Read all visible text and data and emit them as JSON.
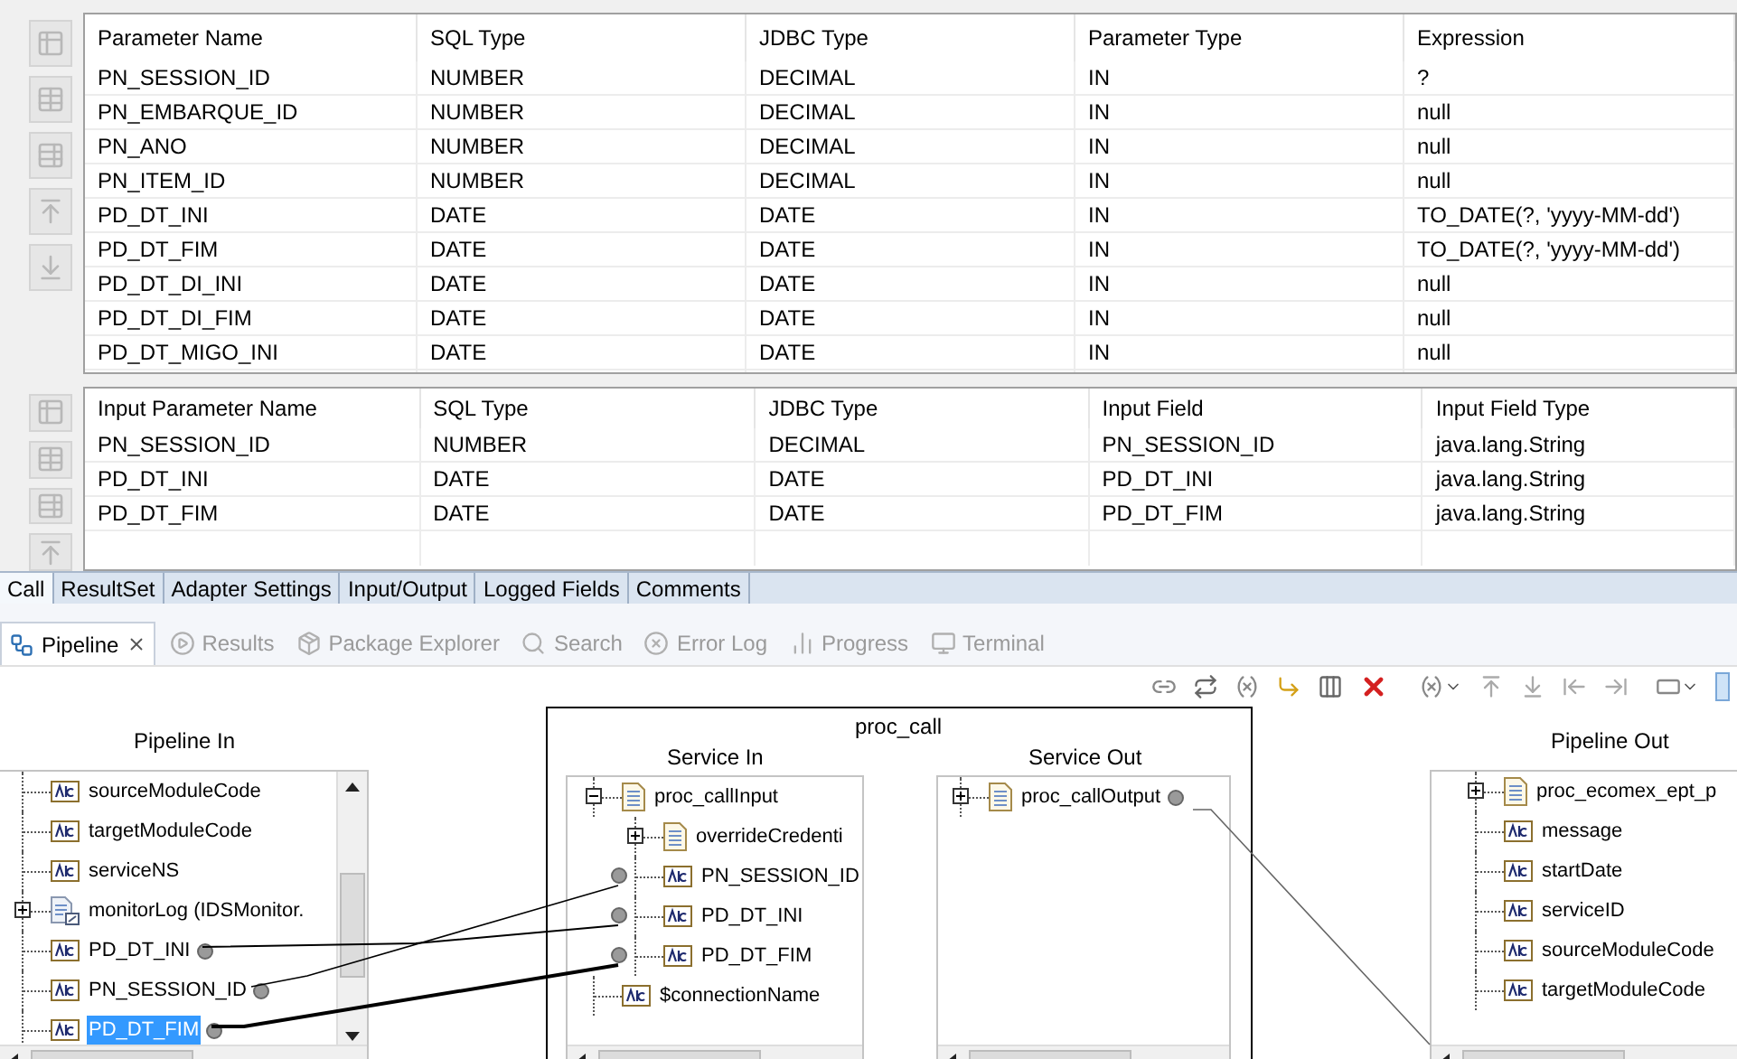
{
  "parameters_table": {
    "columns": [
      "Parameter Name",
      "SQL Type",
      "JDBC Type",
      "Parameter Type",
      "Expression"
    ],
    "rows": [
      [
        "PN_SESSION_ID",
        "NUMBER",
        "DECIMAL",
        "IN",
        "?"
      ],
      [
        "PN_EMBARQUE_ID",
        "NUMBER",
        "DECIMAL",
        "IN",
        "null"
      ],
      [
        "PN_ANO",
        "NUMBER",
        "DECIMAL",
        "IN",
        "null"
      ],
      [
        "PN_ITEM_ID",
        "NUMBER",
        "DECIMAL",
        "IN",
        "null"
      ],
      [
        "PD_DT_INI",
        "DATE",
        "DATE",
        "IN",
        "TO_DATE(?, 'yyyy-MM-dd')"
      ],
      [
        "PD_DT_FIM",
        "DATE",
        "DATE",
        "IN",
        "TO_DATE(?, 'yyyy-MM-dd')"
      ],
      [
        "PD_DT_DI_INI",
        "DATE",
        "DATE",
        "IN",
        "null"
      ],
      [
        "PD_DT_DI_FIM",
        "DATE",
        "DATE",
        "IN",
        "null"
      ],
      [
        "PD_DT_MIGO_INI",
        "DATE",
        "DATE",
        "IN",
        "null"
      ]
    ]
  },
  "input_parameters_table": {
    "columns": [
      "Input Parameter Name",
      "SQL Type",
      "JDBC Type",
      "Input Field",
      "Input Field Type"
    ],
    "rows": [
      [
        "PN_SESSION_ID",
        "NUMBER",
        "DECIMAL",
        "PN_SESSION_ID",
        "java.lang.String"
      ],
      [
        "PD_DT_INI",
        "DATE",
        "DATE",
        "PD_DT_INI",
        "java.lang.String"
      ],
      [
        "PD_DT_FIM",
        "DATE",
        "DATE",
        "PD_DT_FIM",
        "java.lang.String"
      ]
    ]
  },
  "editor_tabs": [
    {
      "label": "Call",
      "selected": true
    },
    {
      "label": "ResultSet",
      "selected": false
    },
    {
      "label": "Adapter Settings",
      "selected": false
    },
    {
      "label": "Input/Output",
      "selected": false
    },
    {
      "label": "Logged Fields",
      "selected": false
    },
    {
      "label": "Comments",
      "selected": false
    }
  ],
  "view_tabs": [
    {
      "label": "Pipeline",
      "selected": true
    },
    {
      "label": "Results",
      "selected": false
    },
    {
      "label": "Package Explorer",
      "selected": false
    },
    {
      "label": "Search",
      "selected": false
    },
    {
      "label": "Error Log",
      "selected": false
    },
    {
      "label": "Progress",
      "selected": false
    },
    {
      "label": "Terminal",
      "selected": false
    }
  ],
  "pipeline": {
    "pipeline_in": {
      "title": "Pipeline In",
      "items": [
        {
          "label": "sourceModuleCode",
          "kind": "string",
          "linked": false,
          "selected": false
        },
        {
          "label": "targetModuleCode",
          "kind": "string",
          "linked": false,
          "selected": false
        },
        {
          "label": "serviceNS",
          "kind": "string",
          "linked": false,
          "selected": false
        },
        {
          "label": "monitorLog (IDSMonitor.",
          "kind": "record",
          "expanded": false,
          "linked": false,
          "selected": false
        },
        {
          "label": "PD_DT_INI",
          "kind": "string",
          "linked": true,
          "selected": false
        },
        {
          "label": "PN_SESSION_ID",
          "kind": "string",
          "linked": true,
          "selected": false
        },
        {
          "label": "PD_DT_FIM",
          "kind": "string",
          "linked": true,
          "selected": true
        }
      ]
    },
    "service": {
      "title": "proc_call",
      "service_in": {
        "title": "Service In",
        "items": [
          {
            "label": "proc_callInput",
            "kind": "document",
            "expanded": true,
            "linked": false,
            "selected": false,
            "children": [
              {
                "label": "overrideCredenti",
                "kind": "document",
                "expanded": false,
                "linked": false,
                "selected": false
              },
              {
                "label": "PN_SESSION_ID",
                "kind": "string",
                "linked": true,
                "selected": false
              },
              {
                "label": "PD_DT_INI",
                "kind": "string",
                "linked": true,
                "selected": false
              },
              {
                "label": "PD_DT_FIM",
                "kind": "string",
                "linked": true,
                "selected": false
              }
            ]
          },
          {
            "label": "$connectionName",
            "kind": "string",
            "linked": false,
            "selected": false
          }
        ]
      },
      "service_out": {
        "title": "Service Out",
        "items": [
          {
            "label": "proc_callOutput",
            "kind": "document",
            "expanded": false,
            "linked": true,
            "selected": false
          }
        ]
      }
    },
    "pipeline_out": {
      "title": "Pipeline Out",
      "items": [
        {
          "label": "proc_ecomex_ept_p",
          "kind": "document",
          "expanded": false,
          "linked": false,
          "selected": false
        },
        {
          "label": "message",
          "kind": "string",
          "linked": false,
          "selected": false
        },
        {
          "label": "startDate",
          "kind": "string",
          "linked": false,
          "selected": false
        },
        {
          "label": "serviceID",
          "kind": "string",
          "linked": false,
          "selected": false
        },
        {
          "label": "sourceModuleCode",
          "kind": "string",
          "linked": false,
          "selected": false
        },
        {
          "label": "targetModuleCode",
          "kind": "string",
          "linked": false,
          "selected": false
        }
      ]
    }
  }
}
